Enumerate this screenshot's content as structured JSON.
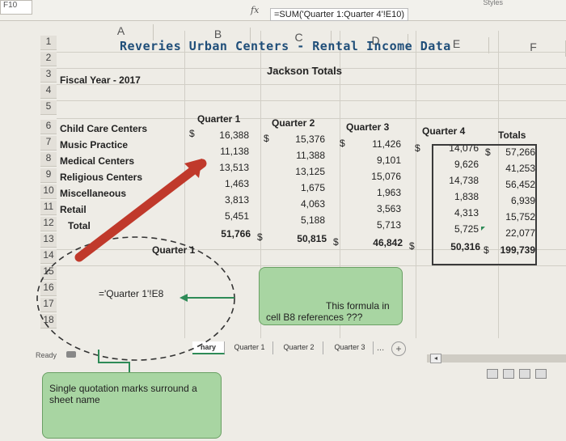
{
  "window": {
    "ribbon_fragment": "Styles",
    "namebox": "F10"
  },
  "formula_bar": {
    "fx": "fx",
    "formula": "=SUM('Quarter 1:Quarter 4'!E10)"
  },
  "columns": [
    "A",
    "B",
    "C",
    "D",
    "E",
    "F"
  ],
  "rows": [
    "1",
    "2",
    "3",
    "4",
    "5",
    "6",
    "7",
    "8",
    "9",
    "10",
    "11",
    "12",
    "13",
    "14",
    "15",
    "16",
    "17",
    "18"
  ],
  "sheet": {
    "title": "Reveries Urban Centers - Rental Income Data",
    "subtitle": "Jackson Totals",
    "fiscal_year": "Fiscal Year - 2017",
    "headers": [
      "Quarter 1",
      "Quarter 2",
      "Quarter 3",
      "Quarter 4",
      "Totals"
    ],
    "categories": [
      {
        "label": "Child Care Centers",
        "q1": "16,388",
        "q2": "15,376",
        "q3": "11,426",
        "q4": "14,076",
        "total": "57,266"
      },
      {
        "label": "Music Practice",
        "q1": "11,138",
        "q2": "11,388",
        "q3": "9,101",
        "q4": "9,626",
        "total": "41,253"
      },
      {
        "label": "Medical Centers",
        "q1": "13,513",
        "q2": "13,125",
        "q3": "15,076",
        "q4": "14,738",
        "total": "56,452"
      },
      {
        "label": "Religious Centers",
        "q1": "1,463",
        "q2": "1,675",
        "q3": "1,963",
        "q4": "1,838",
        "total": "6,939"
      },
      {
        "label": "Miscellaneous",
        "q1": "3,813",
        "q2": "4,063",
        "q3": "3,563",
        "q4": "4,313",
        "total": "15,752"
      },
      {
        "label": "Retail",
        "q1": "5,451",
        "q2": "5,188",
        "q3": "5,713",
        "q4": "5,725",
        "total": "22,077"
      }
    ],
    "total_row": {
      "label": "Total",
      "q1": "51,766",
      "q2": "50,815",
      "q3": "46,842",
      "q4": "50,316",
      "total": "199,739"
    },
    "currency_symbol": "$"
  },
  "annotations": {
    "zoom_formula": "='Quarter 1'!E8",
    "zoom_label": "Quarter 1",
    "callout_formula_text_1": "This formula in",
    "callout_formula_text_2": "cell B8 references ???",
    "callout_quote_text": "Single quotation marks surround a sheet name",
    "accent_red": "#c0392b",
    "callout_green": "#a8d5a2"
  },
  "tabs": {
    "items": [
      "nary",
      "Quarter 1",
      "Quarter 2",
      "Quarter 3"
    ],
    "more": "...",
    "add": "+"
  },
  "status": {
    "ready": "Ready"
  }
}
